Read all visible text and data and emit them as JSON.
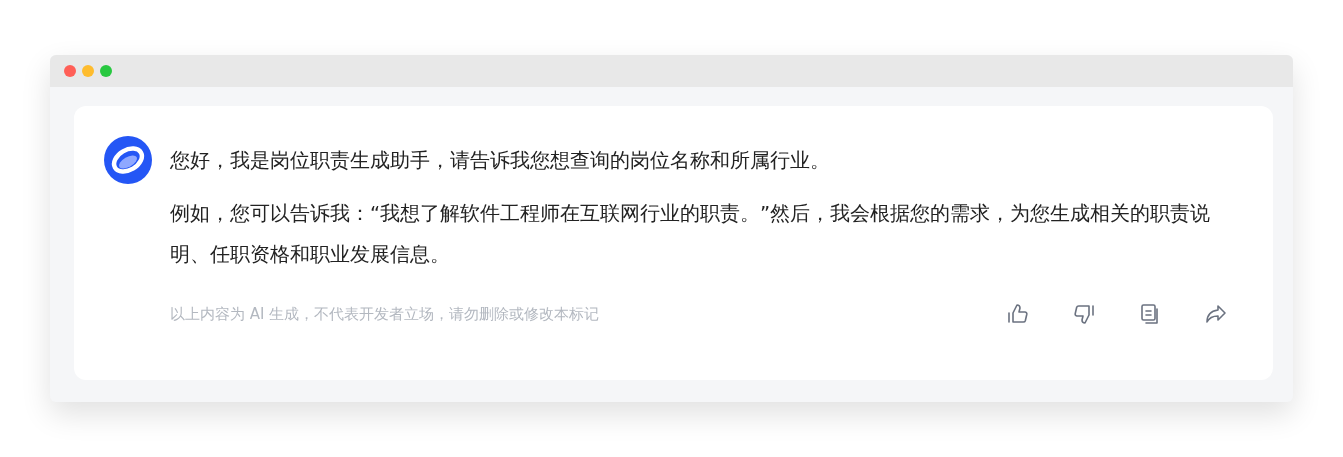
{
  "message": {
    "paragraphs": [
      "您好，我是岗位职责生成助手，请告诉我您想查询的岗位名称和所属行业。",
      "例如，您可以告诉我：“我想了解软件工程师在互联网行业的职责。”然后，我会根据您的需求，为您生成相关的职责说明、任职资格和职业发展信息。"
    ],
    "disclaimer": "以上内容为 AI 生成，不代表开发者立场，请勿删除或修改本标记",
    "actions": [
      {
        "kind": "like"
      },
      {
        "kind": "dislike"
      },
      {
        "kind": "copy"
      },
      {
        "kind": "share"
      }
    ]
  }
}
